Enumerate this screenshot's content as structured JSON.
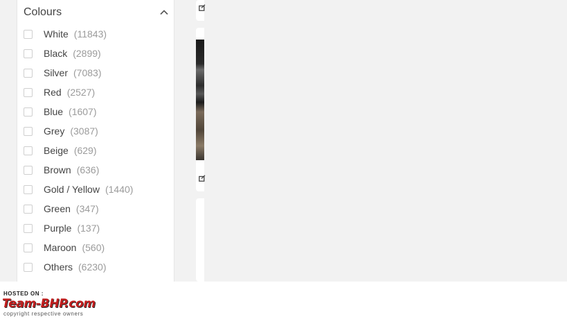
{
  "filter": {
    "title": "Colours",
    "collapse_icon": "chevron-up-icon",
    "options": [
      {
        "label": "White",
        "count": "(11843)"
      },
      {
        "label": "Black",
        "count": "(2899)"
      },
      {
        "label": "Silver",
        "count": "(7083)"
      },
      {
        "label": "Red",
        "count": "(2527)"
      },
      {
        "label": "Blue",
        "count": "(1607)"
      },
      {
        "label": "Grey",
        "count": "(3087)"
      },
      {
        "label": "Beige",
        "count": "(629)"
      },
      {
        "label": "Brown",
        "count": "(636)"
      },
      {
        "label": "Gold / Yellow",
        "count": "(1440)"
      },
      {
        "label": "Green",
        "count": "(347)"
      },
      {
        "label": "Purple",
        "count": "(137)"
      },
      {
        "label": "Maroon",
        "count": "(560)"
      },
      {
        "label": "Others",
        "count": "(6230)"
      }
    ]
  },
  "listing": {
    "share_icon": "share-icon"
  },
  "watermark": {
    "hosted_on": "HOSTED ON :",
    "brand": "Team-BHP.com",
    "copyright": "copyright respective owners"
  },
  "colors": {
    "text": "#444444",
    "count": "#9b9b9b",
    "page_background": "#f2f2f2",
    "brand_red": "#c21e1e"
  }
}
